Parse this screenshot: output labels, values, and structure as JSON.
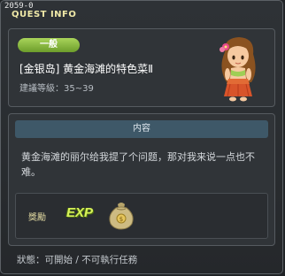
{
  "window": {
    "quest_id": "2059-0",
    "title": "QUEST INFO"
  },
  "quest": {
    "category": "一般",
    "name": "[金银岛] 黄金海滩的特色菜Ⅱ",
    "level_label": "建議等級：",
    "level_range": "35~39",
    "npc_icon": "npc-girl-portrait-icon"
  },
  "content": {
    "header": "内容",
    "description": "黄金海滩的丽尔给我提了个问题，那对我来说一点也不难。"
  },
  "reward": {
    "label": "獎勵",
    "exp_text": "EXP",
    "item_icon": "meso-bag-icon"
  },
  "status": {
    "label": "狀態：",
    "value": "可開始 / 不可執行任務"
  },
  "colors": {
    "badge": "#8cbf3f",
    "title": "#f0e9a8",
    "header_bar": "#3e5868"
  }
}
